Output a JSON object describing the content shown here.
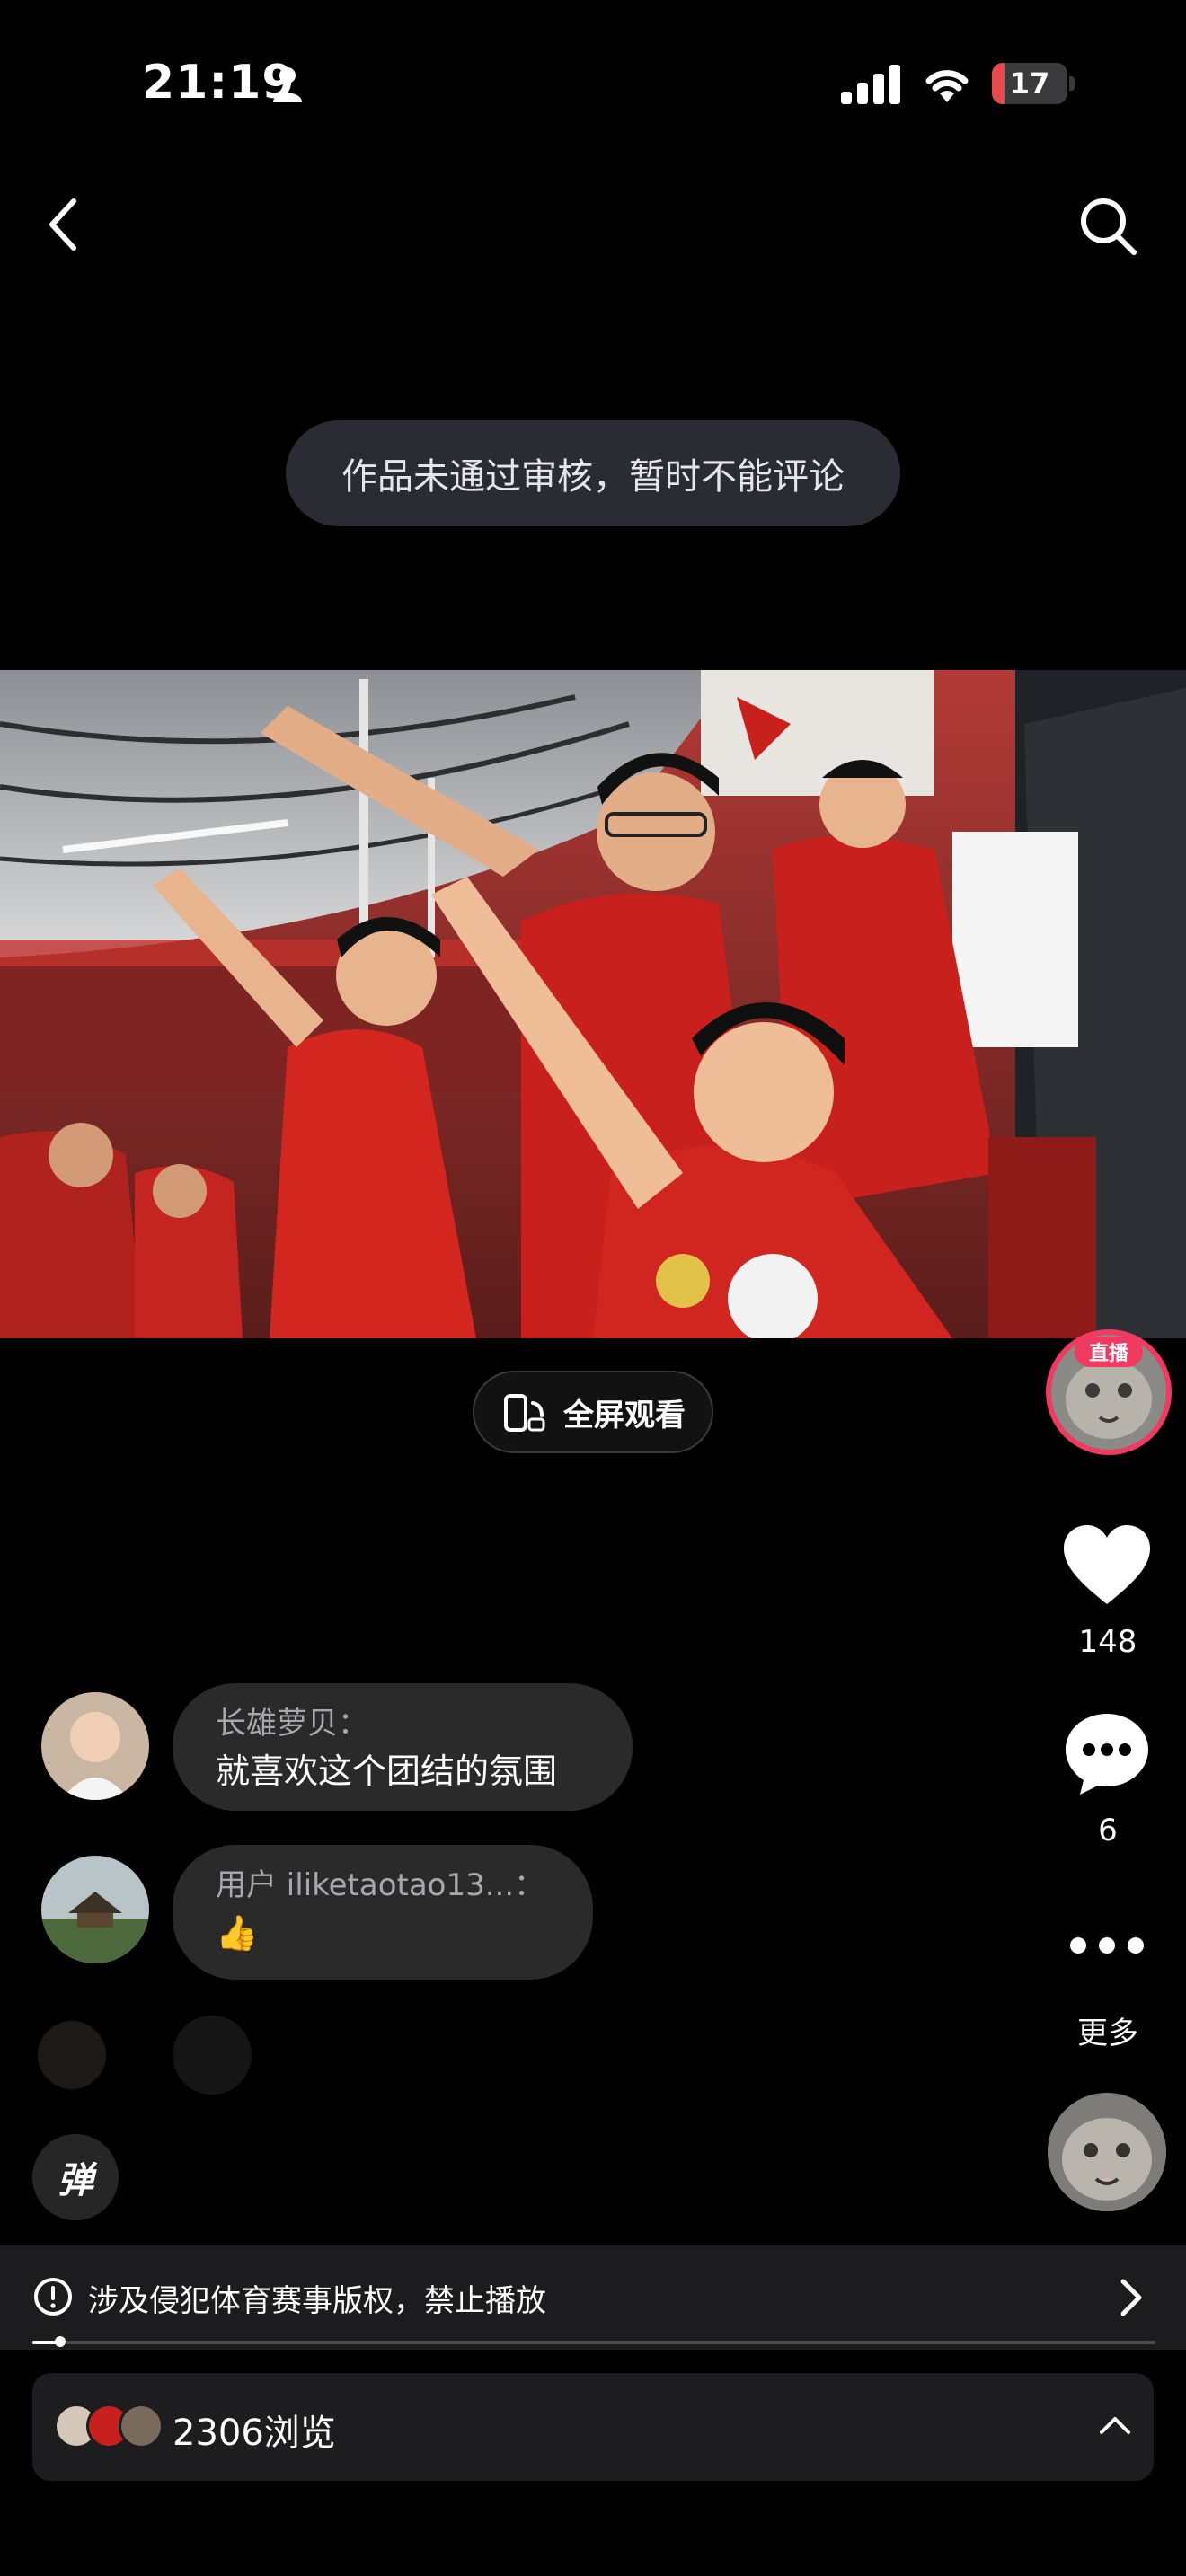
{
  "status_bar": {
    "time": "21:19",
    "battery": "17",
    "battery_level": 0.17
  },
  "toast": {
    "text": "作品未通过审核，暂时不能评论"
  },
  "fullscreen_button": {
    "label": "全屏观看"
  },
  "right_rail": {
    "live_tag": "直播",
    "like_count": "148",
    "comment_count": "6",
    "more_label": "更多"
  },
  "comments": [
    {
      "name": "长雄萝贝：",
      "text": "就喜欢这个团结的氛围"
    },
    {
      "name": "用户 iliketaotao13...：",
      "text": "👍"
    }
  ],
  "danmu_button": {
    "label": "弹"
  },
  "copyright_notice": {
    "text": "涉及侵犯体育赛事版权，禁止播放"
  },
  "playback": {
    "progress": 0.025
  },
  "views": {
    "text": "2306浏览"
  },
  "colors": {
    "accent": "#f03a5f",
    "jersey_red": "#c8201c",
    "background": "#000000"
  }
}
